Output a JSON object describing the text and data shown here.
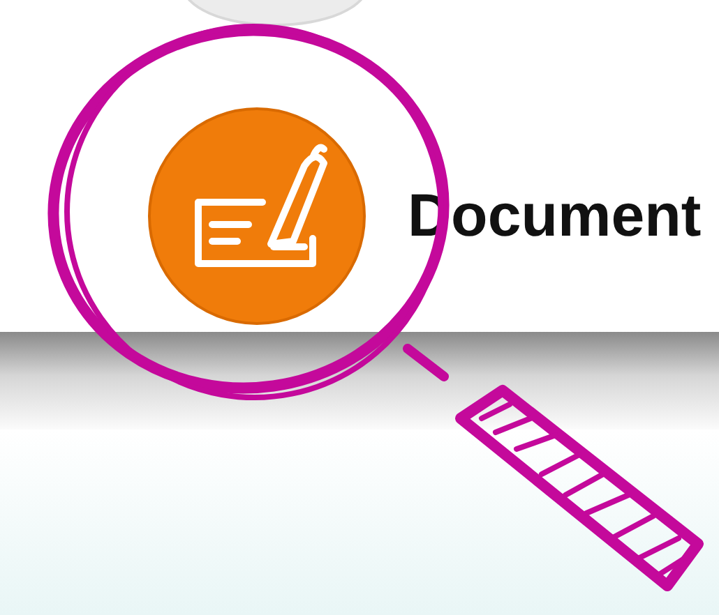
{
  "heading": {
    "text": "Document"
  }
}
